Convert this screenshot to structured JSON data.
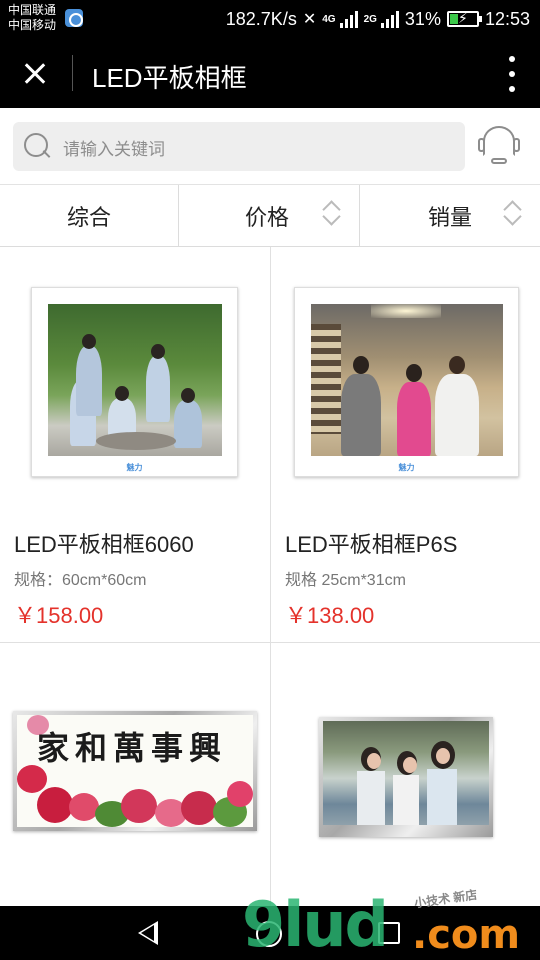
{
  "status_bar": {
    "carrier_1": "中国联通",
    "carrier_2": "中国移动",
    "net_speed": "182.7K/s",
    "network_1": "4G",
    "network_2": "2G",
    "battery_percent": "31%",
    "battery_level": 0.31,
    "time": "12:53",
    "battery_color": "#3cc84a"
  },
  "app_bar": {
    "title": "LED平板相框",
    "close_icon": "close-icon",
    "more_icon": "more-vertical-icon"
  },
  "search": {
    "placeholder": "请输入关键词",
    "service_icon": "customer-service-headset-icon"
  },
  "sort_tabs": [
    {
      "label": "综合"
    },
    {
      "label": "价格"
    },
    {
      "label": "销量"
    }
  ],
  "products": [
    {
      "name": "LED平板相框6060",
      "spec": "规格：60cm*60cm",
      "price": "￥158.00",
      "logo": "魅力"
    },
    {
      "name": "LED平板相框P6S",
      "spec": "规格 25cm*31cm",
      "price": "￥138.00",
      "logo": "魅力"
    },
    {
      "image_text": "家和萬事興"
    },
    {}
  ],
  "watermark": {
    "main": "9lud",
    "suffix": ".com",
    "small": "小技术 新店"
  },
  "colors": {
    "price_red": "#e4322b",
    "bar_black": "#000000",
    "search_bg": "#eeeeee"
  }
}
